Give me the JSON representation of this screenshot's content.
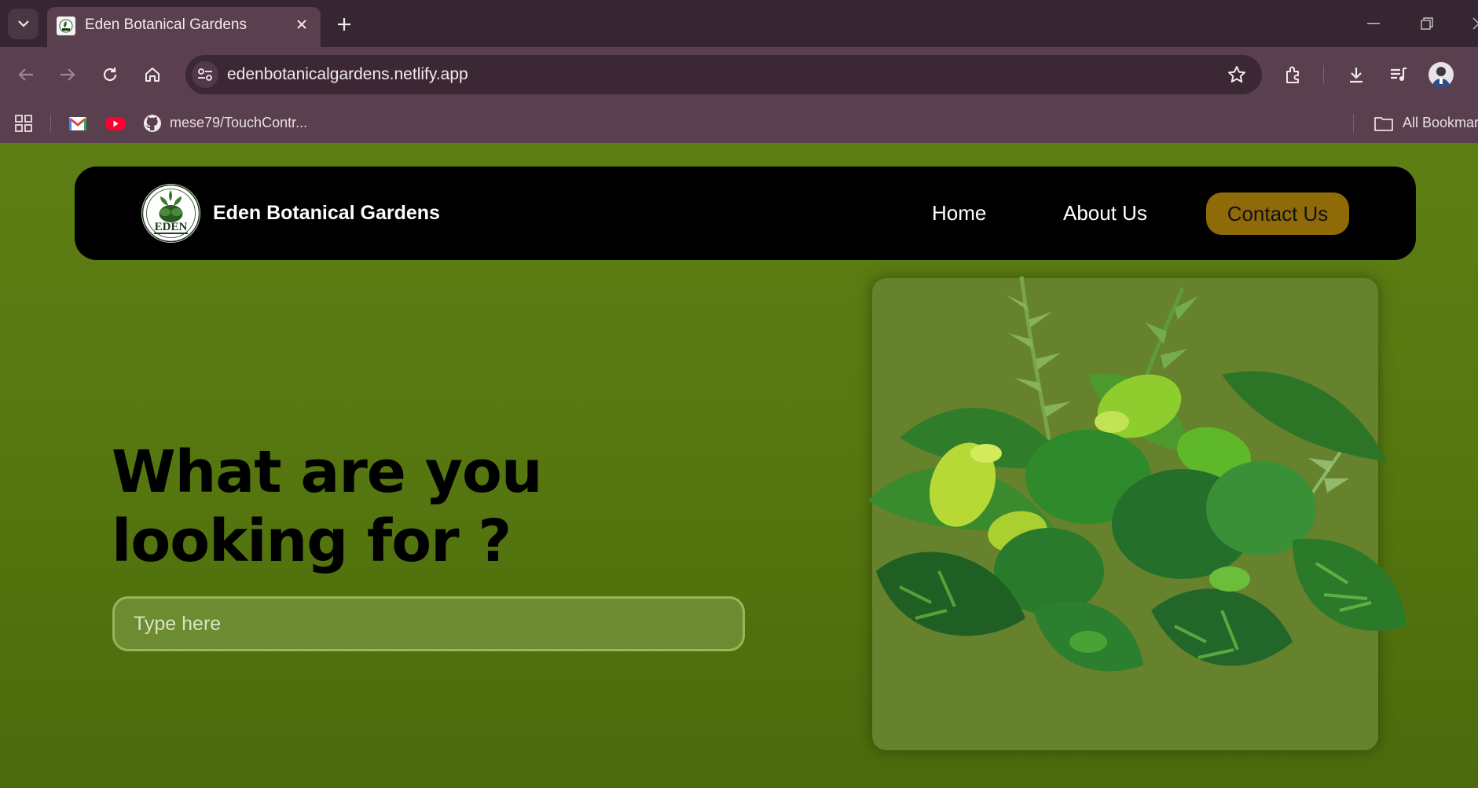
{
  "browser": {
    "tab": {
      "title": "Eden Botanical Gardens"
    },
    "url": "edenbotanicalgardens.netlify.app",
    "bookmarks": [
      {
        "label": "mese79/TouchContr..."
      }
    ],
    "all_bookmarks_label": "All Bookmar"
  },
  "site": {
    "brand": "Eden Botanical Gardens",
    "logo_text": "EDEN",
    "nav": {
      "home": "Home",
      "about": "About Us",
      "contact": "Contact Us"
    },
    "hero": {
      "headline_line1": "What are you",
      "headline_line2": "looking for ?",
      "search_placeholder": "Type here"
    }
  },
  "colors": {
    "page_green": "#5c7e14",
    "navbar": "#000000",
    "contact_button": "#8f6a08",
    "browser_frame": "#5a3f4f"
  }
}
